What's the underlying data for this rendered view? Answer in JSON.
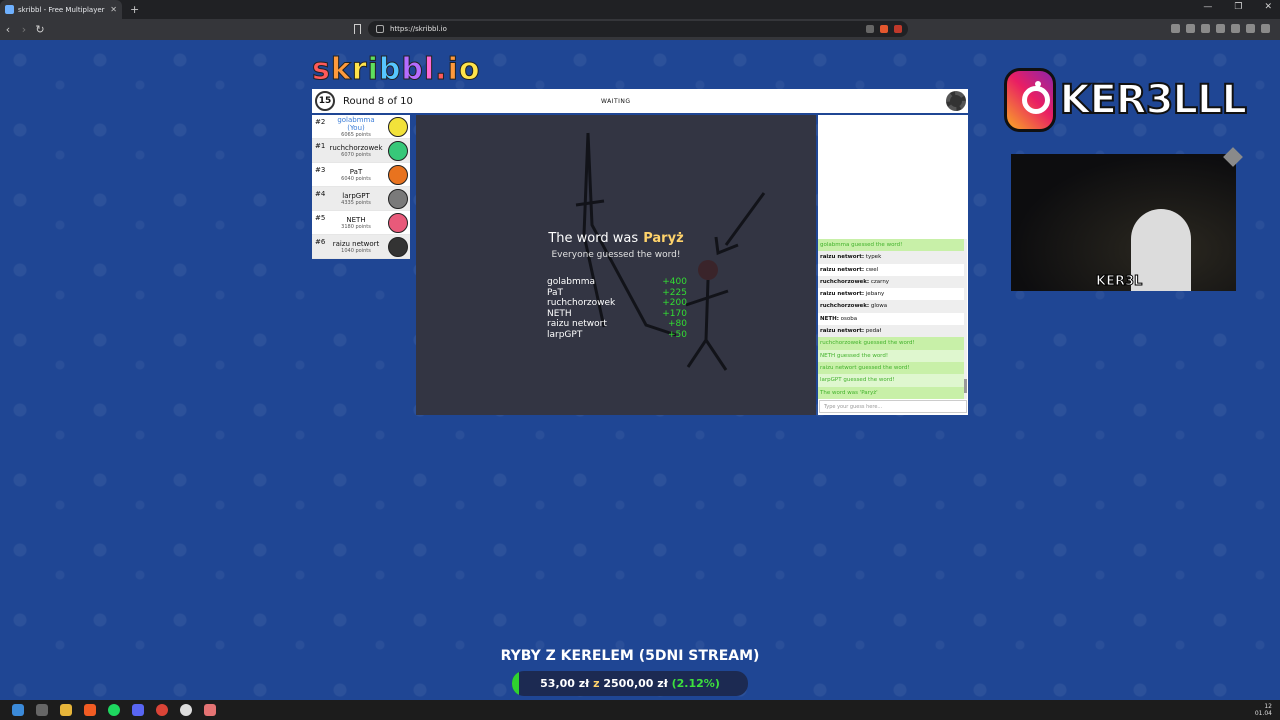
{
  "browser": {
    "tab_title": "skribbl - Free Multiplayer Dra",
    "tab_close": "✕",
    "new_tab": "+",
    "url": "https://skribbl.io",
    "window_controls": [
      "—",
      "❐",
      "✕"
    ]
  },
  "game": {
    "logo": "skribbl.io",
    "timer": "15",
    "round_text": "Round 8 of 10",
    "status": "WAITING",
    "players": [
      {
        "rank": "#2",
        "name": "golabmma (You)",
        "points": "6065 points",
        "color": "#f2e23a",
        "is_you": true
      },
      {
        "rank": "#1",
        "name": "ruchchorzowek",
        "points": "6070 points",
        "color": "#37c879"
      },
      {
        "rank": "#3",
        "name": "PaT",
        "points": "6040 points",
        "color": "#e8731f"
      },
      {
        "rank": "#4",
        "name": "larpGPT",
        "points": "4335 points",
        "color": "#7a7a7a"
      },
      {
        "rank": "#5",
        "name": "NETH",
        "points": "3180 points",
        "color": "#e85a7a"
      },
      {
        "rank": "#6",
        "name": "raizu networt",
        "points": "1040 points",
        "color": "#333333"
      }
    ],
    "reveal": {
      "label": "The word was",
      "word": "Paryż",
      "subtitle": "Everyone guessed the word!"
    },
    "round_scores": [
      {
        "name": "golabmma",
        "score": "+400"
      },
      {
        "name": "PaT",
        "score": "+225"
      },
      {
        "name": "ruchchorzowek",
        "score": "+200"
      },
      {
        "name": "NETH",
        "score": "+170"
      },
      {
        "name": "raizu networt",
        "score": "+80"
      },
      {
        "name": "larpGPT",
        "score": "+50"
      }
    ],
    "chat": [
      {
        "type": "guessed",
        "text": "golabmma guessed the word!"
      },
      {
        "type": "msg",
        "who": "raizu networt:",
        "text": "typek"
      },
      {
        "type": "msg",
        "who": "raizu networt:",
        "text": "cwel"
      },
      {
        "type": "msg",
        "who": "ruchchorzowek:",
        "text": "czarny"
      },
      {
        "type": "msg",
        "who": "raizu networt:",
        "text": "jebany"
      },
      {
        "type": "msg",
        "who": "ruchchorzowek:",
        "text": "glowa"
      },
      {
        "type": "msg",
        "who": "NETH:",
        "text": "osoba"
      },
      {
        "type": "msg",
        "who": "raizu networt:",
        "text": "pedał"
      },
      {
        "type": "guessed",
        "text": "ruchchorzowek guessed the word!"
      },
      {
        "type": "guessed",
        "text": "NETH guessed the word!"
      },
      {
        "type": "guessed",
        "text": "raizu networt guessed the word!"
      },
      {
        "type": "guessed",
        "text": "larpGPT guessed the word!"
      },
      {
        "type": "reveal",
        "text": "The word was 'Paryż'"
      }
    ],
    "chat_placeholder": "Type your guess here..."
  },
  "stream": {
    "ig_handle": "KER3LLL",
    "cam_name": "KER3L",
    "goal_title": "RYBY Z KERELEM (5DNI STREAM)",
    "goal_current": "53,00 zł",
    "goal_sep": "z",
    "goal_target": "2500,00 zł",
    "goal_pct_text": "(2.12%)",
    "goal_fraction": 0.0212
  },
  "taskbar": {
    "time": "12",
    "date": "01.04"
  }
}
